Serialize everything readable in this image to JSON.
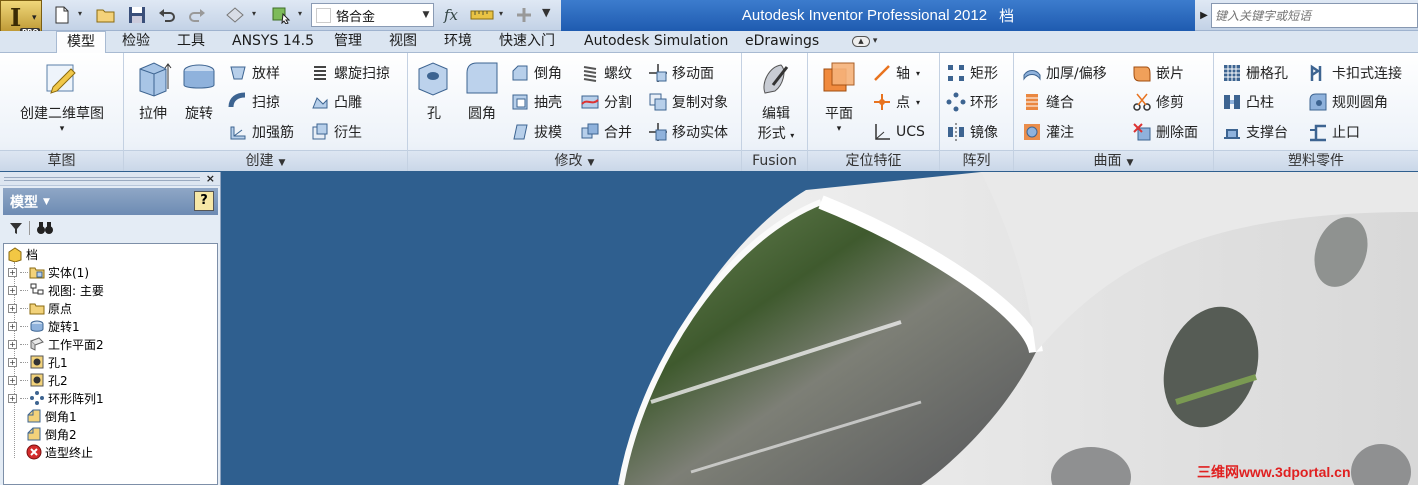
{
  "app": {
    "title": "Autodesk Inventor Professional 2012",
    "document": "档",
    "badge": "PRO"
  },
  "quick_access": {
    "material": "铬合金",
    "fx_label": "fx"
  },
  "help_search": {
    "placeholder": "键入关键字或短语"
  },
  "tabs": [
    "模型",
    "检验",
    "工具",
    "ANSYS 14.5",
    "管理",
    "视图",
    "环境",
    "快速入门",
    "Autodesk Simulation",
    "eDrawings"
  ],
  "ribbon": {
    "sketch": {
      "label": "草图",
      "create_sketch": "创建二维草图"
    },
    "create": {
      "label": "创建",
      "extrude": "拉伸",
      "revolve": "旋转",
      "loft": "放样",
      "sweep": "扫掠",
      "rib": "加强筋",
      "coil": "螺旋扫掠",
      "emboss": "凸雕",
      "derive": "衍生"
    },
    "modify": {
      "label": "修改",
      "hole": "孔",
      "fillet": "圆角",
      "chamfer": "倒角",
      "shell": "抽壳",
      "draft": "拔模",
      "thread": "螺纹",
      "split": "分割",
      "combine": "合并",
      "move_face": "移动面",
      "copy_object": "复制对象",
      "move_body": "移动实体"
    },
    "fusion": {
      "label": "Fusion",
      "edit_form_line1": "编辑",
      "edit_form_line2": "形式"
    },
    "work_features": {
      "label": "定位特征",
      "plane": "平面",
      "axis": "轴",
      "point": "点",
      "ucs": "UCS"
    },
    "pattern": {
      "label": "阵列",
      "rectangular": "矩形",
      "circular": "环形",
      "mirror": "镜像"
    },
    "surface": {
      "label": "曲面",
      "thicken": "加厚/偏移",
      "stitch": "缝合",
      "sculpt": "灌注",
      "patch": "嵌片",
      "trim": "修剪",
      "delete_face": "删除面"
    },
    "plastic": {
      "label": "塑料零件",
      "grill": "栅格孔",
      "boss": "凸柱",
      "rest": "支撑台",
      "snap_fit": "卡扣式连接",
      "rule_fillet": "规则圆角",
      "lip": "止口"
    }
  },
  "browser": {
    "title": "模型",
    "help": "?",
    "tree": [
      {
        "label": "档",
        "icon": "part-icon"
      },
      {
        "label": "实体(1)",
        "icon": "solid-bodies-folder-icon",
        "expandable": true
      },
      {
        "label": "视图: 主要",
        "icon": "view-rep-icon",
        "expandable": true
      },
      {
        "label": "原点",
        "icon": "origin-folder-icon",
        "expandable": true
      },
      {
        "label": "旋转1",
        "icon": "revolve-feature-icon",
        "expandable": true
      },
      {
        "label": "工作平面2",
        "icon": "work-plane-icon",
        "expandable": true
      },
      {
        "label": "孔1",
        "icon": "hole-feature-icon",
        "expandable": true
      },
      {
        "label": "孔2",
        "icon": "hole-feature-icon",
        "expandable": true
      },
      {
        "label": "环形阵列1",
        "icon": "circular-pattern-icon",
        "expandable": true
      },
      {
        "label": "倒角1",
        "icon": "chamfer-feature-icon"
      },
      {
        "label": "倒角2",
        "icon": "chamfer-feature-icon"
      },
      {
        "label": "造型终止",
        "icon": "end-of-part-icon"
      }
    ]
  },
  "watermark": "三维网www.3dportal.cn",
  "colors": {
    "viewport_bg": "#2f5f8e",
    "title_bar": "#2a66bd",
    "accent_orange": "#e8731f"
  }
}
